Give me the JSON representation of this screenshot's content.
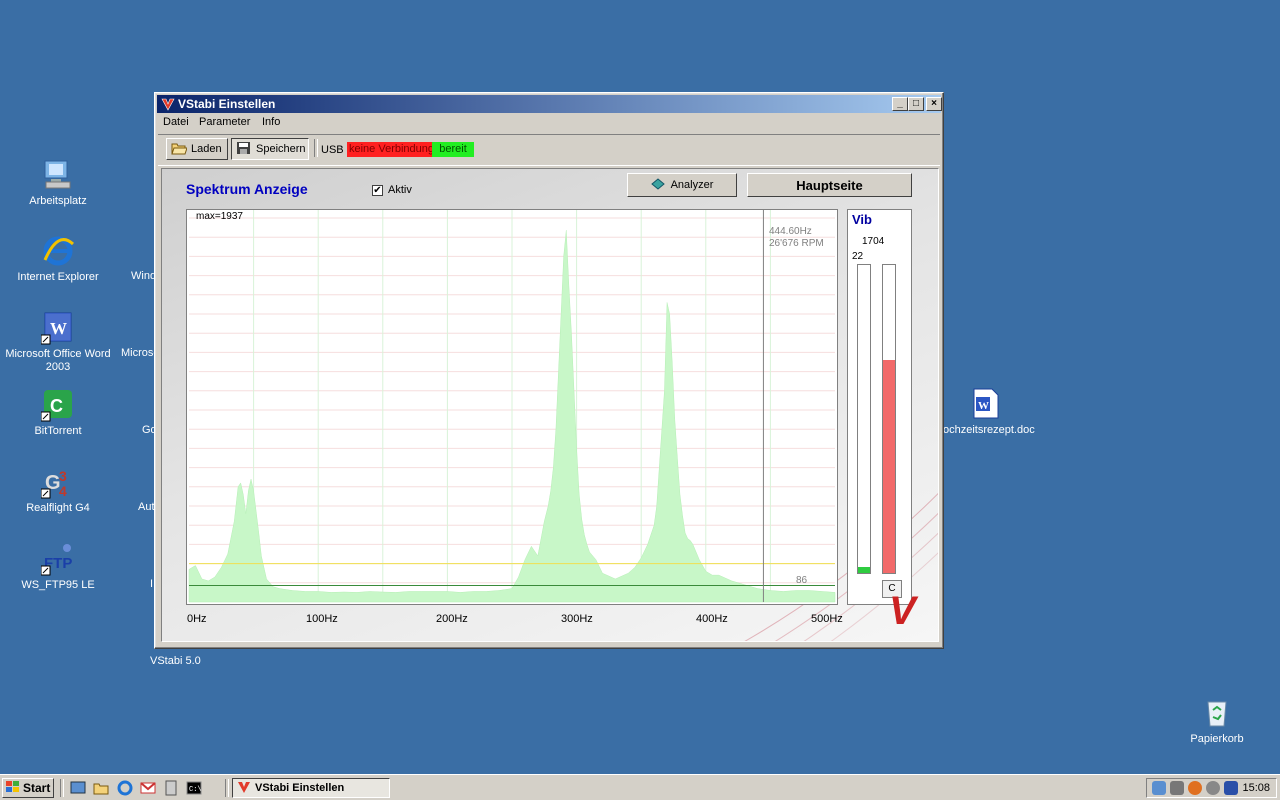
{
  "desktop": {
    "icons": [
      {
        "label": "Arbeitsplatz"
      },
      {
        "label": "Internet Explorer"
      },
      {
        "label": "Microsoft Office Word 2003"
      },
      {
        "label": "BitTorrent"
      },
      {
        "label": "Realflight G4"
      },
      {
        "label": "WS_FTP95 LE"
      },
      {
        "label": "Papierkorb"
      }
    ],
    "partial_labels": [
      "Wind",
      "Microso",
      "Go",
      "Aut",
      "I"
    ],
    "doc_label": "ochzeitsrezept.doc",
    "below_window_label": "VStabi 5.0"
  },
  "window": {
    "title": "VStabi Einstellen",
    "controls": {
      "minimize": "_",
      "maximize": "□",
      "close": "×"
    },
    "menu": [
      "Datei",
      "Parameter",
      "Info"
    ],
    "toolbar": {
      "load_label": "Laden",
      "save_label": "Speichern",
      "usb_label": "USB",
      "status_connection": "keine Verbindung",
      "status_ready": "bereit"
    },
    "panel": {
      "title": "Spektrum Anzeige",
      "aktiv_label": "Aktiv",
      "aktiv_checked": "✔",
      "analyzer_label": "Analyzer",
      "hauptseite_label": "Hauptseite"
    },
    "vib": {
      "title": "Vib",
      "value": "1704",
      "min_label": "22",
      "left_bar_level": 0.02,
      "right_bar_level": 0.69,
      "c_label": "C"
    }
  },
  "chart_data": {
    "type": "area",
    "max_label": "max=1937",
    "freq_readout": "444.60Hz",
    "rpm_readout": "26'676 RPM",
    "cursor_hz": 444.6,
    "threshold_label": "86",
    "threshold_value": 86,
    "reference_level": 200,
    "xlim": [
      0,
      500
    ],
    "ylim": [
      0,
      2000
    ],
    "x_tick_labels": [
      "0Hz",
      "100Hz",
      "200Hz",
      "300Hz",
      "400Hz",
      "500Hz"
    ],
    "x_tick_values": [
      0,
      100,
      200,
      300,
      400,
      500
    ],
    "series": [
      {
        "color": "#c8f7c8",
        "x": [
          0,
          5,
          10,
          15,
          20,
          25,
          30,
          35,
          38,
          40,
          42,
          44,
          46,
          48,
          50,
          52,
          54,
          56,
          58,
          60,
          65,
          70,
          75,
          80,
          90,
          100,
          110,
          120,
          130,
          140,
          150,
          160,
          170,
          180,
          190,
          200,
          210,
          220,
          230,
          240,
          250,
          255,
          260,
          265,
          270,
          275,
          278,
          280,
          282,
          284,
          286,
          288,
          290,
          292,
          294,
          296,
          298,
          300,
          302,
          304,
          306,
          308,
          310,
          315,
          320,
          330,
          340,
          345,
          350,
          355,
          360,
          362,
          364,
          366,
          368,
          370,
          372,
          374,
          376,
          378,
          380,
          382,
          384,
          386,
          388,
          390,
          395,
          400,
          405,
          410,
          420,
          430,
          440,
          450,
          460,
          470,
          480,
          490,
          500
        ],
        "y": [
          170,
          190,
          120,
          110,
          130,
          180,
          250,
          420,
          600,
          620,
          560,
          460,
          580,
          640,
          580,
          470,
          360,
          240,
          180,
          120,
          80,
          70,
          65,
          60,
          55,
          55,
          50,
          52,
          50,
          55,
          52,
          50,
          55,
          55,
          55,
          55,
          50,
          55,
          55,
          60,
          70,
          130,
          220,
          290,
          240,
          420,
          500,
          580,
          700,
          900,
          1200,
          1500,
          1800,
          1937,
          1650,
          1400,
          1100,
          800,
          560,
          430,
          350,
          300,
          260,
          220,
          150,
          120,
          150,
          180,
          230,
          300,
          400,
          500,
          700,
          900,
          1100,
          1560,
          1500,
          1250,
          950,
          750,
          560,
          450,
          360,
          330,
          320,
          300,
          220,
          160,
          140,
          140,
          110,
          90,
          70,
          60,
          55,
          60,
          60,
          55,
          50
        ]
      }
    ]
  },
  "taskbar": {
    "start_label": "Start",
    "task_label": "VStabi Einstellen",
    "clock": "15:08"
  }
}
